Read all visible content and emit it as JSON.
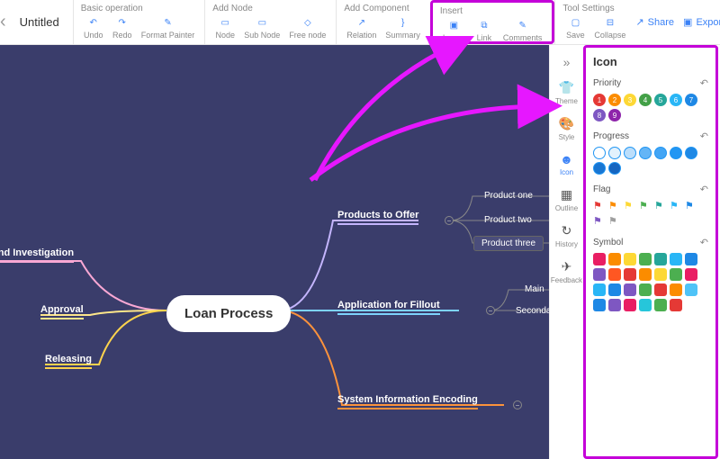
{
  "title": "Untitled",
  "toolbar": {
    "groups": {
      "basic": {
        "title": "Basic operation",
        "undo": "Undo",
        "redo": "Redo",
        "format": "Format Painter"
      },
      "add": {
        "title": "Add Node",
        "node": "Node",
        "sub": "Sub Node",
        "free": "Free node"
      },
      "comp": {
        "title": "Add Component",
        "rel": "Relation",
        "sum": "Summary"
      },
      "insert": {
        "title": "Insert",
        "img": "Image",
        "link": "Link",
        "comm": "Comments"
      },
      "tool": {
        "title": "Tool Settings",
        "save": "Save",
        "coll": "Collapse"
      }
    },
    "share": "Share",
    "export": "Export"
  },
  "mind": {
    "center": "Loan Process",
    "left": {
      "a": "round Investigation",
      "b": "Approval",
      "c": "Releasing"
    },
    "right": {
      "a": "Products to Offer",
      "a1": "Product one",
      "a2": "Product two",
      "a3": "Product three",
      "b": "Application for Fillout",
      "b1": "Main",
      "b2": "Seconda",
      "c": "System Information Encoding"
    }
  },
  "rail": {
    "theme": "Theme",
    "style": "Style",
    "icon": "Icon",
    "outline": "Outline",
    "history": "History",
    "feedback": "Feedback"
  },
  "panel": {
    "title": "Icon",
    "priority": "Priority",
    "progress": "Progress",
    "flag": "Flag",
    "symbol": "Symbol",
    "prio_colors": [
      "#e53935",
      "#fb8c00",
      "#fdd835",
      "#43a047",
      "#26a69a",
      "#29b6f6",
      "#1e88e5",
      "#7e57c2",
      "#8e24aa"
    ],
    "prog_colors": [
      "#fff",
      "#e3f2fd",
      "#bbdefb",
      "#64b5f6",
      "#42a5f5",
      "#2196f3",
      "#1e88e5",
      "#1976d2",
      "#1565c0"
    ],
    "flag_colors": [
      "#e53935",
      "#fb8c00",
      "#fdd835",
      "#4caf50",
      "#26a69a",
      "#29b6f6",
      "#1e88e5",
      "#7e57c2",
      "#9e9e9e"
    ],
    "sym_colors": [
      "#e91e63",
      "#fb8c00",
      "#fdd835",
      "#4caf50",
      "#26a69a",
      "#29b6f6",
      "#1e88e5",
      "#7e57c2",
      "#ff5722",
      "#e53935",
      "#fb8c00",
      "#fdd835",
      "#4caf50",
      "#e91e63",
      "#29b6f6",
      "#1e88e5",
      "#7e57c2",
      "#4caf50",
      "#e53935",
      "#fb8c00",
      "#4fc3f7",
      "#1e88e5",
      "#7e57c2",
      "#e91e63",
      "#26c6da",
      "#4caf50",
      "#e53935"
    ]
  }
}
